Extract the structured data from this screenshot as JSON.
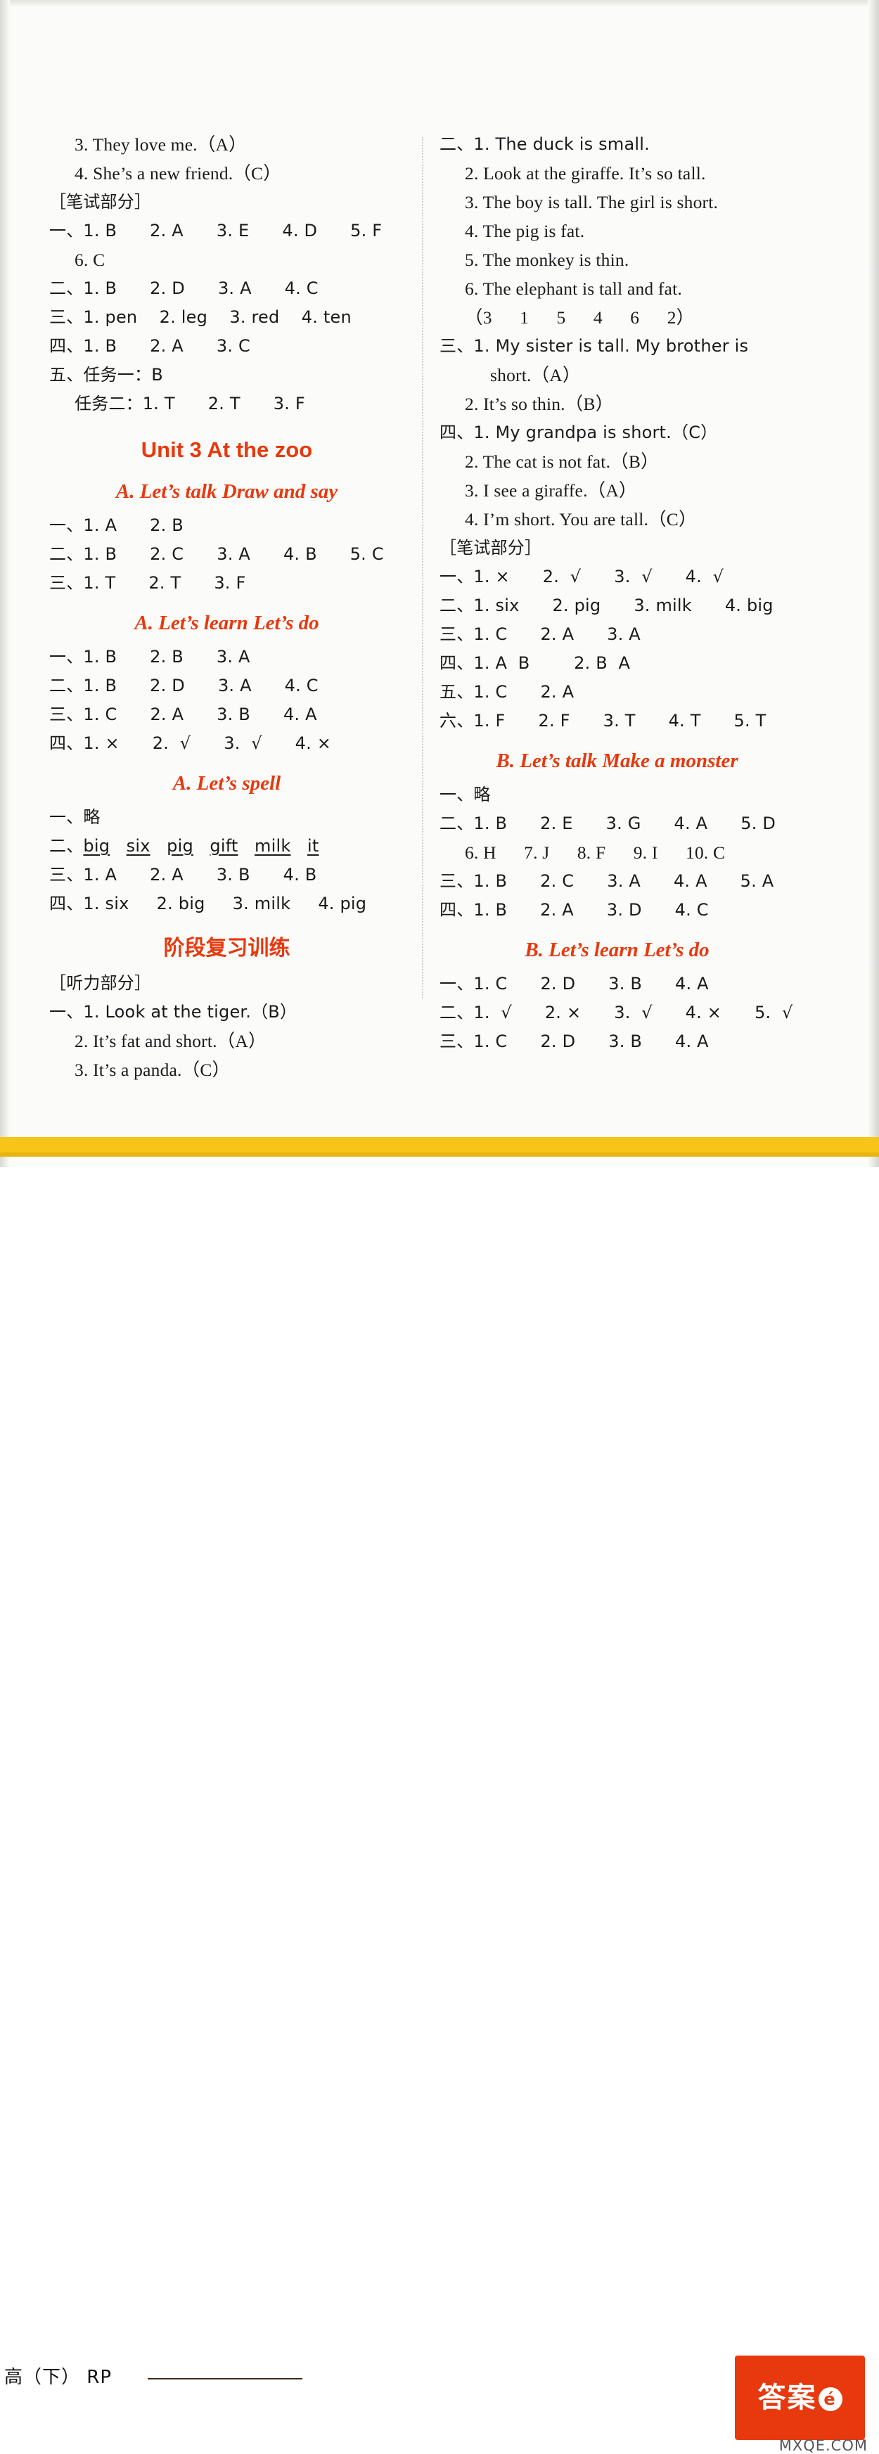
{
  "page": {
    "footer_left": "高（下） RP",
    "logo_text": "答案",
    "logo_badge": "é",
    "watermark": "MXQE.COM"
  },
  "left_column": [
    {
      "type": "line",
      "indent": 1,
      "text": "3. They love me.（A）"
    },
    {
      "type": "line",
      "indent": 1,
      "text": "4. She’s a new friend.（C）"
    },
    {
      "type": "line",
      "indent": 0,
      "cn": true,
      "text": "［笔试部分］"
    },
    {
      "type": "line",
      "indent": 0,
      "cn": true,
      "text": "一、1. B      2. A      3. E      4. D      5. F"
    },
    {
      "type": "line",
      "indent": 1,
      "text": "6. C"
    },
    {
      "type": "line",
      "indent": 0,
      "cn": true,
      "text": "二、1. B      2. D      3. A      4. C"
    },
    {
      "type": "line",
      "indent": 0,
      "cn": true,
      "text": "三、1. pen    2. leg    3. red    4. ten"
    },
    {
      "type": "line",
      "indent": 0,
      "cn": true,
      "text": "四、1. B      2. A      3. C"
    },
    {
      "type": "line",
      "indent": 0,
      "cn": true,
      "text": "五、任务一：B"
    },
    {
      "type": "line",
      "indent": 1,
      "cn": true,
      "text": "任务二：1. T      2. T      3. F"
    },
    {
      "type": "heading-unit",
      "text": "Unit 3    At the zoo"
    },
    {
      "type": "heading-red",
      "text": "A. Let’s talk   Draw and say"
    },
    {
      "type": "line",
      "indent": 0,
      "cn": true,
      "text": "一、1. A      2. B"
    },
    {
      "type": "line",
      "indent": 0,
      "cn": true,
      "text": "二、1. B      2. C      3. A      4. B      5. C"
    },
    {
      "type": "line",
      "indent": 0,
      "cn": true,
      "text": "三、1. T      2. T      3. F"
    },
    {
      "type": "heading-red",
      "text": "A. Let’s learn   Let’s do"
    },
    {
      "type": "line",
      "indent": 0,
      "cn": true,
      "text": "一、1. B      2. B      3. A"
    },
    {
      "type": "line",
      "indent": 0,
      "cn": true,
      "text": "二、1. B      2. D      3. A      4. C"
    },
    {
      "type": "line",
      "indent": 0,
      "cn": true,
      "text": "三、1. C      2. A      3. B      4. A"
    },
    {
      "type": "line",
      "indent": 0,
      "cn": true,
      "text": "四、1. ×      2.  √      3.  √      4. ×"
    },
    {
      "type": "heading-red",
      "text": "A. Let’s spell"
    },
    {
      "type": "line",
      "indent": 0,
      "cn": true,
      "text": "一、略"
    },
    {
      "type": "line-underline",
      "indent": 0,
      "cn": true,
      "prefix": "二、",
      "words": [
        "big",
        "six",
        "pig",
        "gift",
        "milk",
        "it"
      ]
    },
    {
      "type": "line",
      "indent": 0,
      "cn": true,
      "text": "三、1. A      2. A      3. B      4. B"
    },
    {
      "type": "line",
      "indent": 0,
      "cn": true,
      "text": "四、1. six     2. big     3. milk     4. pig"
    },
    {
      "type": "heading-cn",
      "text": "阶段复习训练"
    },
    {
      "type": "line",
      "indent": 0,
      "cn": true,
      "text": "［听力部分］"
    },
    {
      "type": "line",
      "indent": 0,
      "cn": true,
      "text": "一、1. Look at the tiger.（B）"
    },
    {
      "type": "line",
      "indent": 1,
      "text": "2. It’s fat and short.（A）"
    },
    {
      "type": "line",
      "indent": 1,
      "text": "3. It’s a panda.（C）"
    }
  ],
  "right_column": [
    {
      "type": "line",
      "indent": 0,
      "cn": true,
      "text": "二、1. The duck is small."
    },
    {
      "type": "line",
      "indent": 1,
      "text": "2. Look at the giraffe. It’s so tall."
    },
    {
      "type": "line",
      "indent": 1,
      "text": "3. The boy is tall. The girl is short."
    },
    {
      "type": "line",
      "indent": 1,
      "text": "4. The pig is fat."
    },
    {
      "type": "line",
      "indent": 1,
      "text": "5. The monkey is thin."
    },
    {
      "type": "line",
      "indent": 1,
      "text": "6. The elephant is tall and fat."
    },
    {
      "type": "line",
      "indent": 1,
      "text": "（3      1      5      4      6      2）"
    },
    {
      "type": "line",
      "indent": 0,
      "cn": true,
      "text": "三、1. My sister is tall. My brother is"
    },
    {
      "type": "line",
      "indent": 2,
      "text": "short.（A）"
    },
    {
      "type": "line",
      "indent": 1,
      "text": "2. It’s so thin.（B）"
    },
    {
      "type": "line",
      "indent": 0,
      "cn": true,
      "text": "四、1. My grandpa is short.（C）"
    },
    {
      "type": "line",
      "indent": 1,
      "text": "2. The cat is not fat.（B）"
    },
    {
      "type": "line",
      "indent": 1,
      "text": "3. I see a giraffe.（A）"
    },
    {
      "type": "line",
      "indent": 1,
      "text": "4. I’m short. You are tall.（C）"
    },
    {
      "type": "line",
      "indent": 0,
      "cn": true,
      "text": "［笔试部分］"
    },
    {
      "type": "line",
      "indent": 0,
      "cn": true,
      "text": "一、1. ×      2.  √      3.  √      4.  √"
    },
    {
      "type": "line",
      "indent": 0,
      "cn": true,
      "text": "二、1. six      2. pig      3. milk      4. big"
    },
    {
      "type": "line",
      "indent": 0,
      "cn": true,
      "text": "三、1. C      2. A      3. A"
    },
    {
      "type": "line",
      "indent": 0,
      "cn": true,
      "text": "四、1. A  B        2. B  A"
    },
    {
      "type": "line",
      "indent": 0,
      "cn": true,
      "text": "五、1. C      2. A"
    },
    {
      "type": "line",
      "indent": 0,
      "cn": true,
      "text": "六、1. F      2. F      3. T      4. T      5. T"
    },
    {
      "type": "heading-red",
      "text": "B. Let’s talk   Make a monster"
    },
    {
      "type": "line",
      "indent": 0,
      "cn": true,
      "text": "一、略"
    },
    {
      "type": "line",
      "indent": 0,
      "cn": true,
      "text": "二、1. B      2. E      3. G      4. A      5. D"
    },
    {
      "type": "line",
      "indent": 1,
      "text": "6. H      7. J      8. F      9. I      10. C"
    },
    {
      "type": "line",
      "indent": 0,
      "cn": true,
      "text": "三、1. B      2. C      3. A      4. A      5. A"
    },
    {
      "type": "line",
      "indent": 0,
      "cn": true,
      "text": "四、1. B      2. A      3. D      4. C"
    },
    {
      "type": "heading-red",
      "text": "B. Let’s learn   Let’s do"
    },
    {
      "type": "line",
      "indent": 0,
      "cn": true,
      "text": "一、1. C      2. D      3. B      4. A"
    },
    {
      "type": "line",
      "indent": 0,
      "cn": true,
      "text": "二、1.  √      2. ×      3.  √      4. ×      5.  √"
    },
    {
      "type": "line",
      "indent": 0,
      "cn": true,
      "text": "三、1. C      2. D      3. B      4. A"
    }
  ]
}
